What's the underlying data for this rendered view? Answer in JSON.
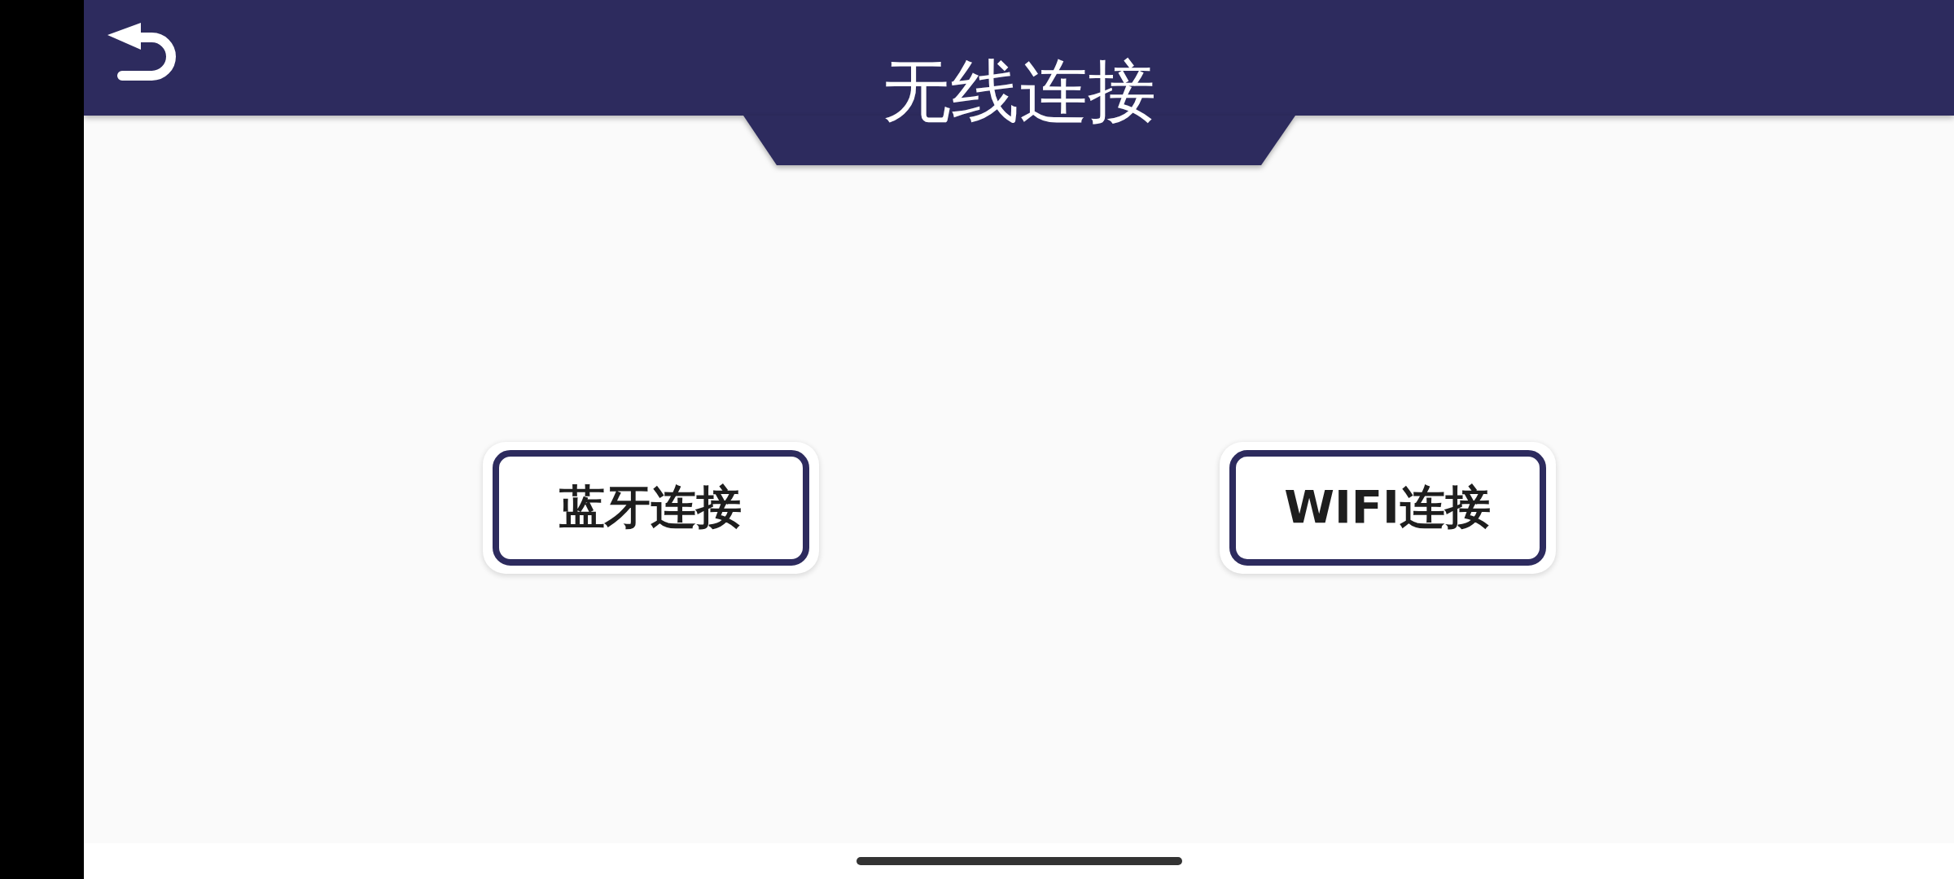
{
  "header": {
    "title": "无线连接"
  },
  "buttons": [
    {
      "label": "蓝牙连接"
    },
    {
      "label": "WIFI连接"
    }
  ]
}
